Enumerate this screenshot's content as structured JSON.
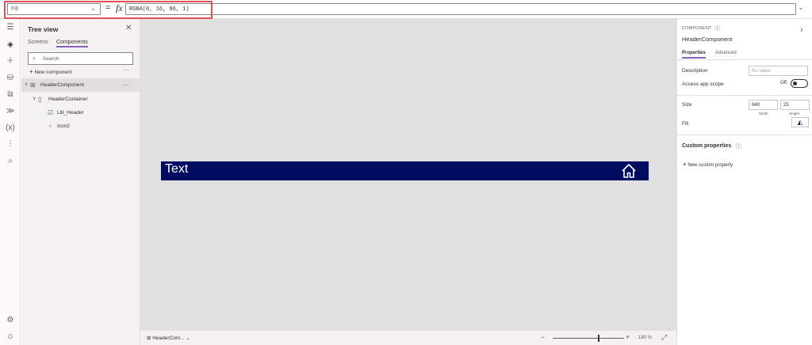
{
  "formula_bar": {
    "property": "Fill",
    "equals": "=",
    "fx": "fx",
    "formula": "RGBA(0, 16, 96, 1)"
  },
  "tree_view": {
    "title": "Tree view",
    "tabs": [
      "Screens",
      "Components"
    ],
    "active_tab": "Components",
    "search_placeholder": "Search",
    "new_component": "New component",
    "items": [
      {
        "label": "HeaderComponent",
        "level": 0,
        "selected": true,
        "icon": "component-icon"
      },
      {
        "label": "HeaderContainer",
        "level": 1,
        "selected": false,
        "icon": "container-icon"
      },
      {
        "label": "Lbl_Header",
        "level": 2,
        "selected": false,
        "icon": "label-icon"
      },
      {
        "label": "Icon2",
        "level": 2,
        "selected": false,
        "icon": "icon-control-icon"
      }
    ]
  },
  "canvas": {
    "header_text": "Text",
    "header_color": "#000c60",
    "background": "#e1e0e0"
  },
  "status_bar": {
    "component": "HeaderCom...",
    "zoom": "180 %",
    "zoom_fraction": 0.63
  },
  "properties": {
    "type_label": "COMPONENT",
    "name": "HeaderComponent",
    "tabs": [
      "Properties",
      "Advanced"
    ],
    "active_tab": "Properties",
    "description_label": "Description",
    "description_placeholder": "No value",
    "access_scope_label": "Access app scope",
    "access_scope_value": "Off",
    "size_label": "Size",
    "width": "640",
    "height": "25",
    "width_label": "Width",
    "height_label": "Height",
    "fill_label": "Fill",
    "custom_properties_label": "Custom properties",
    "new_custom_property": "New custom property"
  },
  "colors": {
    "accent": "#8764b8",
    "highlight": "#e0515a"
  }
}
